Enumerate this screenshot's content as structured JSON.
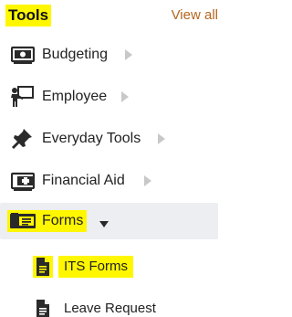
{
  "header": {
    "title": "Tools",
    "view_all": "View all"
  },
  "menu": {
    "items": [
      {
        "label": "Budgeting",
        "icon": "money-icon",
        "has_submenu": true
      },
      {
        "label": "Employee",
        "icon": "presenter-icon",
        "has_submenu": true
      },
      {
        "label": "Everyday Tools",
        "icon": "pin-icon",
        "has_submenu": true
      },
      {
        "label": "Financial Aid",
        "icon": "medical-kit-icon",
        "has_submenu": true
      },
      {
        "label": "Forms",
        "icon": "folder-icon",
        "expanded": true
      }
    ],
    "subitems": [
      {
        "label": "ITS Forms",
        "icon": "document-icon"
      },
      {
        "label": "Leave Request",
        "icon": "document-icon"
      }
    ]
  },
  "colors": {
    "highlight": "#fff700",
    "accent": "#b5651d",
    "icon": "#2a2a2a",
    "chevron": "#c8c8c8",
    "active_bg": "#eceef2"
  }
}
